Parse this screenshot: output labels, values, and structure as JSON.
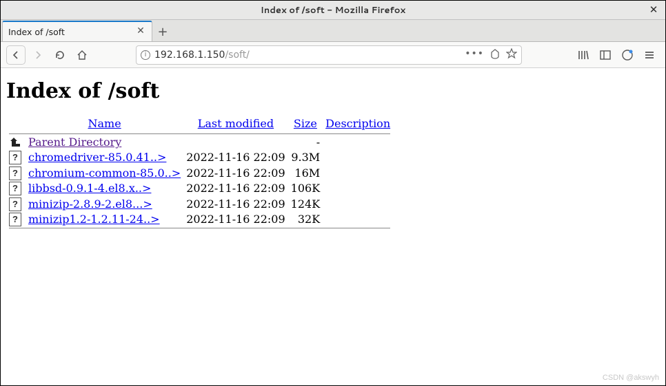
{
  "window": {
    "title": "Index of /soft - Mozilla Firefox"
  },
  "tab": {
    "label": "Index of /soft"
  },
  "url": {
    "host": "192.168.1.150",
    "path": "/soft/"
  },
  "page": {
    "heading": "Index of /soft"
  },
  "columns": {
    "name": "Name",
    "modified": "Last modified",
    "size": "Size",
    "description": "Description"
  },
  "parent": {
    "label": "Parent Directory",
    "size": "-"
  },
  "files": [
    {
      "name": "chromedriver-85.0.41..>",
      "modified": "2022-11-16 22:09",
      "size": "9.3M"
    },
    {
      "name": "chromium-common-85.0..>",
      "modified": "2022-11-16 22:09",
      "size": "16M"
    },
    {
      "name": "libbsd-0.9.1-4.el8.x..>",
      "modified": "2022-11-16 22:09",
      "size": "106K"
    },
    {
      "name": "minizip-2.8.9-2.el8...>",
      "modified": "2022-11-16 22:09",
      "size": "124K"
    },
    {
      "name": "minizip1.2-1.2.11-24..>",
      "modified": "2022-11-16 22:09",
      "size": "32K"
    }
  ],
  "watermark": "CSDN @akswyh"
}
